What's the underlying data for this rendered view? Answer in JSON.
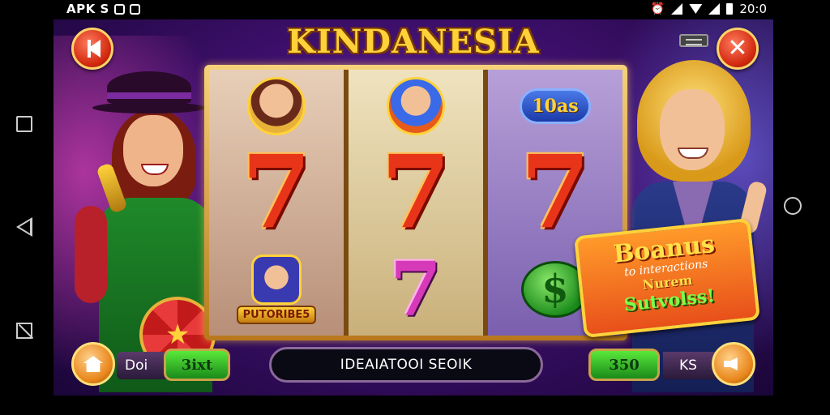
{
  "status_bar": {
    "left_text": "APK S",
    "time": "20:0"
  },
  "game": {
    "title": "KINDANESIA",
    "reels": [
      {
        "top": "portrait",
        "middle": "7",
        "bottom": "PUTORIBE5"
      },
      {
        "top": "character-emblem",
        "middle": "7",
        "bottom": "7"
      },
      {
        "top": "10as",
        "middle": "7",
        "bottom": "$"
      }
    ],
    "bonus": {
      "title": "Boanus",
      "line2": "to interactions",
      "line3": "Nurem",
      "line4": "Sutvolss!"
    },
    "bottom_bar": {
      "left_label": "Doi",
      "bet_value": "3ixt",
      "status_text": "IDEAIATOOI SEOIK",
      "win_value": "350",
      "right_label": "KS"
    }
  },
  "icons": {
    "back": "back-arrow-icon",
    "close": "close-icon",
    "menu": "menu-icon",
    "home": "home-icon",
    "sound": "speaker-icon"
  },
  "colors": {
    "background": "#3d0f6b",
    "title": "#ffd23a",
    "seven": "#e8351a",
    "button_red": "#d22a10",
    "button_orange": "#e8861a",
    "pill_green": "#1a8a1a"
  }
}
